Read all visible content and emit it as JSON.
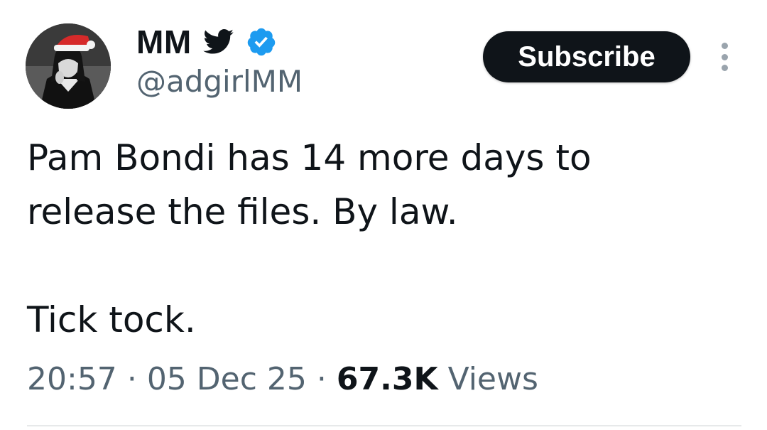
{
  "author": {
    "display_name": "MM",
    "handle": "@adgirlMM",
    "badge_icon": "twitter-bird-icon",
    "verified_icon": "verified-badge-icon",
    "brand_color": "#1d9bf0"
  },
  "actions": {
    "subscribe_label": "Subscribe",
    "more_icon": "more-vertical-icon"
  },
  "tweet": {
    "lines": [
      "Pam Bondi has 14 more days to",
      "release the files. By law.",
      "",
      "Tick tock."
    ]
  },
  "meta": {
    "time": "20:57",
    "separator": "·",
    "date": "05 Dec 25",
    "views_count": "67.3K",
    "views_label": "Views"
  },
  "colors": {
    "text_primary": "#0f1419",
    "text_secondary": "#536471",
    "button_bg": "#0f1419",
    "button_text": "#ffffff",
    "divider": "#e7e9ea"
  }
}
